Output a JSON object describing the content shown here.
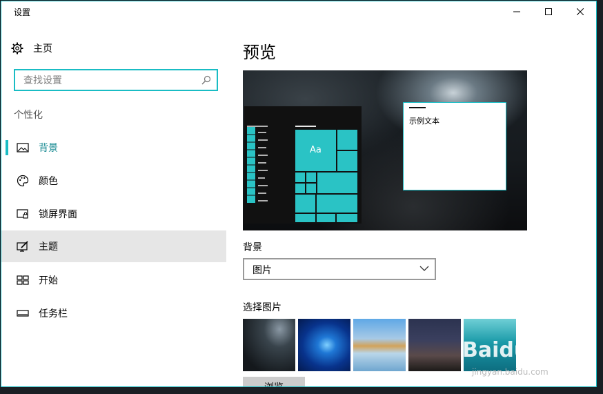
{
  "window": {
    "title": "设置"
  },
  "sidebar": {
    "home_label": "主页",
    "search_placeholder": "查找设置",
    "section_label": "个性化",
    "items": [
      {
        "label": "背景",
        "icon": "image-icon"
      },
      {
        "label": "颜色",
        "icon": "palette-icon"
      },
      {
        "label": "锁屏界面",
        "icon": "lock-screen-icon"
      },
      {
        "label": "主题",
        "icon": "theme-icon"
      },
      {
        "label": "开始",
        "icon": "start-icon"
      },
      {
        "label": "任务栏",
        "icon": "taskbar-icon"
      }
    ],
    "active_item": "背景",
    "hover_item": "主题"
  },
  "main": {
    "preview_title": "预览",
    "preview": {
      "tile_label": "Aa",
      "sample_text": "示例文本"
    },
    "background_label": "背景",
    "background_value": "图片",
    "choose_picture_label": "选择图片",
    "browse_label": "浏览"
  },
  "watermark": {
    "main": "Baidu经验",
    "sub": "jingyan.baidu.com"
  },
  "colors": {
    "accent": "#19bcc4",
    "active_text": "#178a92",
    "hover_bg": "#e6e6e6",
    "tile": "#2ac3c5"
  }
}
